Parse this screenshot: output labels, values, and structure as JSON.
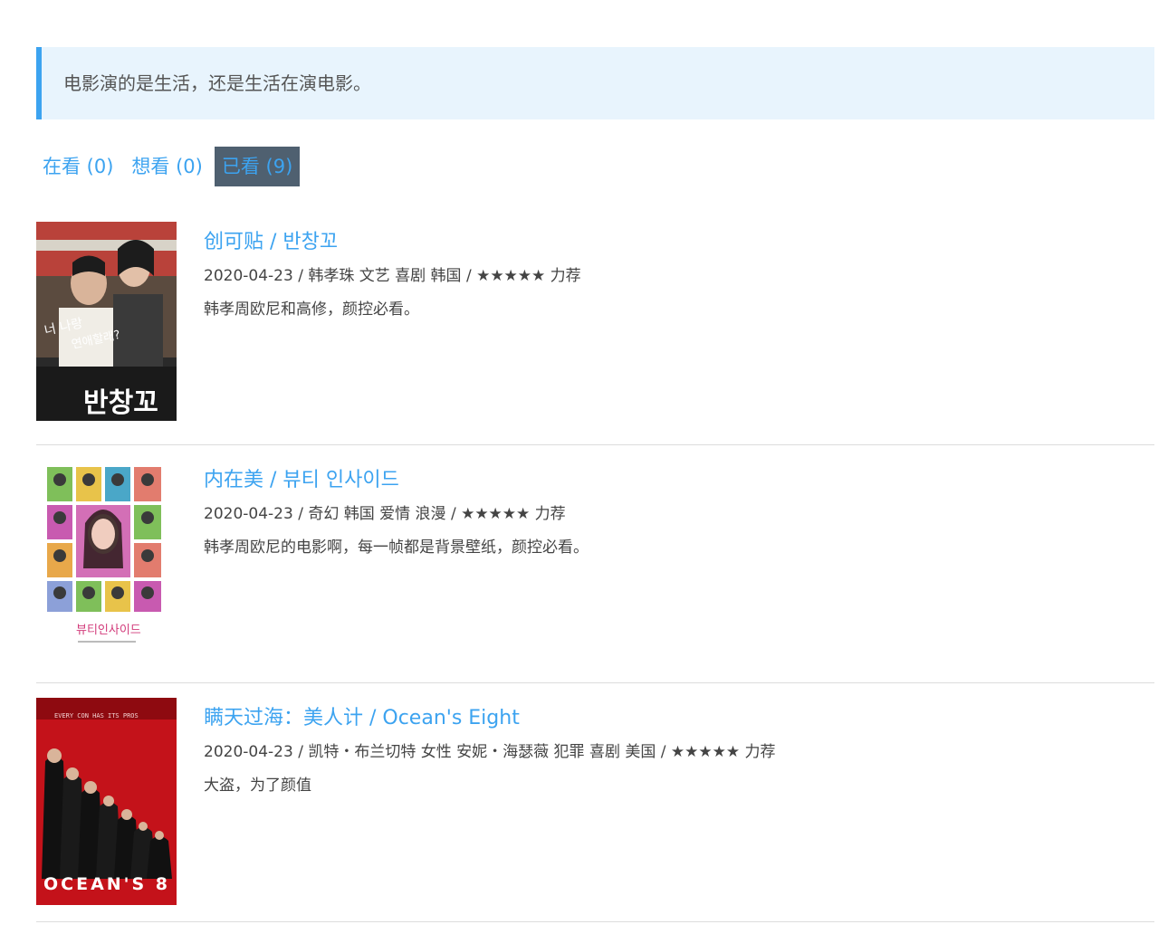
{
  "banner": {
    "quote": "电影演的是生活，还是生活在演电影。"
  },
  "tabs": [
    {
      "label": "在看 (0)",
      "active": false
    },
    {
      "label": "想看 (0)",
      "active": false
    },
    {
      "label": "已看 (9)",
      "active": true
    }
  ],
  "movies": [
    {
      "title": "创可贴 / 반창꼬",
      "meta": "2020-04-23 / 韩孝珠 文艺 喜剧 韩国 / ★★★★★ 力荐",
      "comment": "韩孝周欧尼和高修，颜控必看。",
      "poster_text": "반창꼬",
      "poster_icon": "movie-poster"
    },
    {
      "title": "内在美 / 뷰티 인사이드",
      "meta": "2020-04-23 / 奇幻 韩国 爱情 浪漫 / ★★★★★ 力荐",
      "comment": "韩孝周欧尼的电影啊，每一帧都是背景壁纸，颜控必看。",
      "poster_text": "뷰티인사이드",
      "poster_icon": "movie-poster"
    },
    {
      "title": "瞒天过海：美人计 / Ocean's Eight",
      "meta": "2020-04-23 / 凯特・布兰切特 女性 安妮・海瑟薇 犯罪 喜剧 美国 / ★★★★★ 力荐",
      "comment": "大盗，为了颜值",
      "poster_text": "OCEAN'S 8",
      "poster_icon": "movie-poster"
    }
  ],
  "colors": {
    "accent": "#3ca3f0",
    "active_tab_bg": "#4f6070",
    "banner_bg": "#e8f4fd"
  }
}
